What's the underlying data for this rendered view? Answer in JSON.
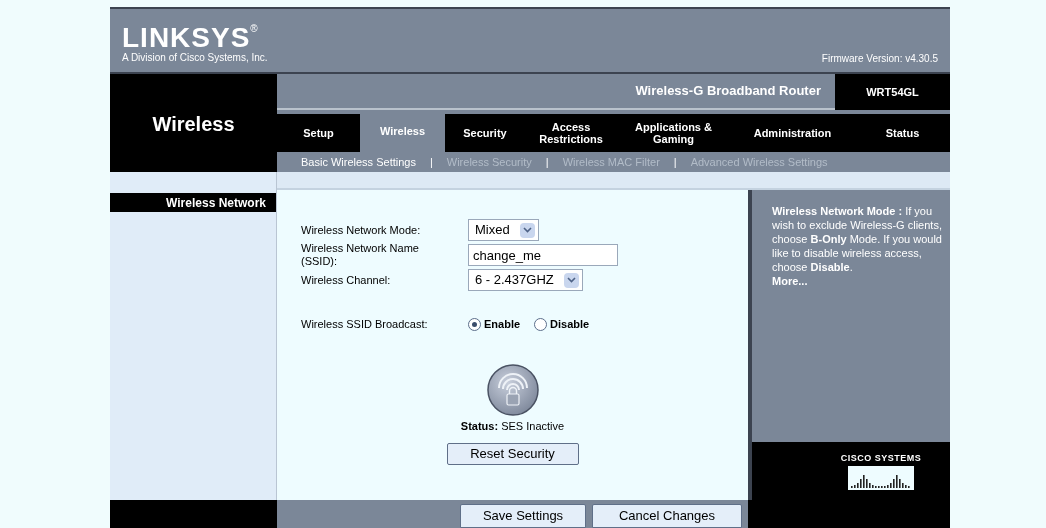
{
  "header": {
    "brand": "LINKSYS",
    "registered": "®",
    "tagline": "A Division of Cisco Systems, Inc.",
    "firmware": "Firmware Version: v4.30.5"
  },
  "product": {
    "name": "Wireless-G Broadband Router",
    "model": "WRT54GL"
  },
  "section_title": "Wireless",
  "tabs": [
    {
      "label": "Setup",
      "selected": false
    },
    {
      "label": "Wireless",
      "selected": true
    },
    {
      "label": "Security",
      "selected": false
    },
    {
      "label": "Access Restrictions",
      "selected": false
    },
    {
      "label": "Applications & Gaming",
      "selected": false
    },
    {
      "label": "Administration",
      "selected": false
    },
    {
      "label": "Status",
      "selected": false
    }
  ],
  "subnav": [
    {
      "kind": "link",
      "label": "Basic Wireless Settings",
      "selected": true
    },
    {
      "kind": "separator",
      "label": "|"
    },
    {
      "kind": "link",
      "label": "Wireless Security",
      "selected": false
    },
    {
      "kind": "separator",
      "label": "|"
    },
    {
      "kind": "link",
      "label": "Wireless MAC Filter",
      "selected": false
    },
    {
      "kind": "separator",
      "label": "|"
    },
    {
      "kind": "link",
      "label": "Advanced Wireless Settings",
      "selected": false
    }
  ],
  "sidebar": {
    "heading": "Wireless Network"
  },
  "form": [
    {
      "kind": "select",
      "label": "Wireless Network Mode:",
      "value": "Mixed"
    },
    {
      "kind": "text",
      "label": "Wireless Network Name (SSID):",
      "value": "change_me"
    },
    {
      "kind": "select",
      "label": "Wireless Channel:",
      "value": "6 - 2.437GHZ"
    },
    {
      "kind": "radio",
      "label": "Wireless SSID Broadcast:",
      "options": [
        {
          "label": "Enable",
          "selected": true
        },
        {
          "label": "Disable",
          "selected": false
        }
      ]
    }
  ],
  "ses": {
    "status": "**Status:** SES Inactive",
    "button": "Reset Security"
  },
  "help": {
    "text": "**Wireless Network Mode :** If you wish to exclude Wireless-G clients, choose **B-Only** Mode. If you would like to disable wireless access, choose **Disable**.",
    "more": "More..."
  },
  "footer": {
    "buttons": [
      "Save Settings",
      "Cancel Changes"
    ]
  },
  "cisco": {
    "text": "CISCO SYSTEMS"
  }
}
